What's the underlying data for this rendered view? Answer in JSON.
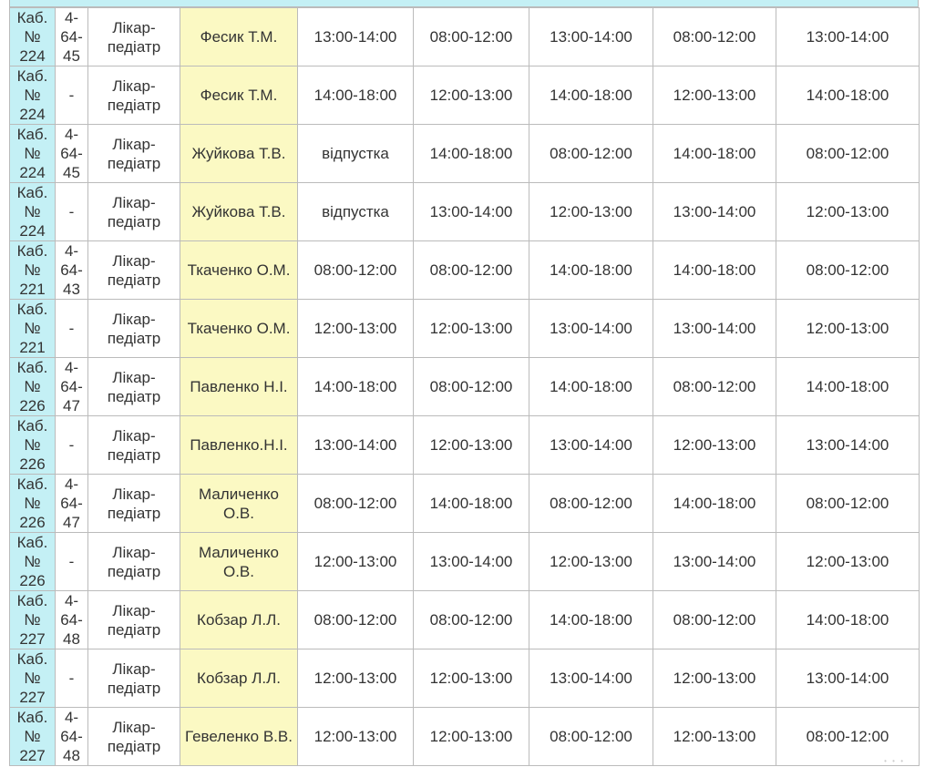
{
  "rows": [
    {
      "cab": [
        "Каб.",
        "№",
        "224"
      ],
      "phone": [
        "4-",
        "64-",
        "45"
      ],
      "role": [
        "Лікар-",
        "педіатр"
      ],
      "name": [
        "Фесик Т.М."
      ],
      "times": [
        "13:00-14:00",
        "08:00-12:00",
        "13:00-14:00",
        "08:00-12:00",
        "13:00-14:00"
      ]
    },
    {
      "cab": [
        "Каб.",
        "№",
        "224"
      ],
      "phone": [
        "-"
      ],
      "role": [
        "Лікар-",
        "педіатр"
      ],
      "name": [
        "Фесик Т.М."
      ],
      "times": [
        "14:00-18:00",
        "12:00-13:00",
        "14:00-18:00",
        "12:00-13:00",
        "14:00-18:00"
      ]
    },
    {
      "cab": [
        "Каб.",
        "№",
        "224"
      ],
      "phone": [
        "4-",
        "64-",
        "45"
      ],
      "role": [
        "Лікар-",
        "педіатр"
      ],
      "name": [
        "Жуйкова Т.В."
      ],
      "times": [
        "відпустка",
        "14:00-18:00",
        "08:00-12:00",
        "14:00-18:00",
        "08:00-12:00"
      ]
    },
    {
      "cab": [
        "Каб.",
        "№",
        "224"
      ],
      "phone": [
        "-"
      ],
      "role": [
        "Лікар-",
        "педіатр"
      ],
      "name": [
        "Жуйкова Т.В."
      ],
      "times": [
        "відпустка",
        "13:00-14:00",
        "12:00-13:00",
        "13:00-14:00",
        "12:00-13:00"
      ]
    },
    {
      "cab": [
        "Каб.",
        "№",
        "221"
      ],
      "phone": [
        "4-",
        "64-",
        "43"
      ],
      "role": [
        "Лікар-",
        "педіатр"
      ],
      "name": [
        "Ткаченко О.М."
      ],
      "times": [
        "08:00-12:00",
        "08:00-12:00",
        "14:00-18:00",
        "14:00-18:00",
        "08:00-12:00"
      ]
    },
    {
      "cab": [
        "Каб.",
        "№",
        "221"
      ],
      "phone": [
        "-"
      ],
      "role": [
        "Лікар-",
        "педіатр"
      ],
      "name": [
        "Ткаченко О.М."
      ],
      "times": [
        "12:00-13:00",
        "12:00-13:00",
        "13:00-14:00",
        "13:00-14:00",
        "12:00-13:00"
      ]
    },
    {
      "cab": [
        "Каб.",
        "№",
        "226"
      ],
      "phone": [
        "4-",
        "64-",
        "47"
      ],
      "role": [
        "Лікар-",
        "педіатр"
      ],
      "name": [
        "Павленко Н.І."
      ],
      "times": [
        "14:00-18:00",
        "08:00-12:00",
        "14:00-18:00",
        "08:00-12:00",
        "14:00-18:00"
      ]
    },
    {
      "cab": [
        "Каб.",
        "№",
        "226"
      ],
      "phone": [
        "-"
      ],
      "role": [
        "Лікар-",
        "педіатр"
      ],
      "name": [
        "Павленко.Н.І."
      ],
      "times": [
        "13:00-14:00",
        "12:00-13:00",
        "13:00-14:00",
        "12:00-13:00",
        "13:00-14:00"
      ]
    },
    {
      "cab": [
        "Каб.",
        "№",
        "226"
      ],
      "phone": [
        "4-",
        "64-",
        "47"
      ],
      "role": [
        "Лікар-",
        "педіатр"
      ],
      "name": [
        "Маличенко",
        "О.В."
      ],
      "times": [
        "08:00-12:00",
        "14:00-18:00",
        "08:00-12:00",
        "14:00-18:00",
        "08:00-12:00"
      ]
    },
    {
      "cab": [
        "Каб.",
        "№",
        "226"
      ],
      "phone": [
        "-"
      ],
      "role": [
        "Лікар-",
        "педіатр"
      ],
      "name": [
        "Маличенко",
        "О.В."
      ],
      "times": [
        "12:00-13:00",
        "13:00-14:00",
        "12:00-13:00",
        "13:00-14:00",
        "12:00-13:00"
      ]
    },
    {
      "cab": [
        "Каб.",
        "№",
        "227"
      ],
      "phone": [
        "4-",
        "64-",
        "48"
      ],
      "role": [
        "Лікар-",
        "педіатр"
      ],
      "name": [
        "Кобзар Л.Л."
      ],
      "times": [
        "08:00-12:00",
        "08:00-12:00",
        "14:00-18:00",
        "08:00-12:00",
        "14:00-18:00"
      ]
    },
    {
      "cab": [
        "Каб.",
        "№",
        "227"
      ],
      "phone": [
        "-"
      ],
      "role": [
        "Лікар-",
        "педіатр"
      ],
      "name": [
        "Кобзар Л.Л."
      ],
      "times": [
        "12:00-13:00",
        "12:00-13:00",
        "13:00-14:00",
        "12:00-13:00",
        "13:00-14:00"
      ]
    },
    {
      "cab": [
        "Каб.",
        "№",
        "227"
      ],
      "phone": [
        "4-",
        "64-",
        "48"
      ],
      "role": [
        "Лікар-",
        "педіатр"
      ],
      "name": [
        "Гевеленко В.В."
      ],
      "times": [
        "12:00-13:00",
        "12:00-13:00",
        "08:00-12:00",
        "12:00-13:00",
        "08:00-12:00"
      ]
    }
  ],
  "colors": {
    "cab_bg": "#c4f0f5",
    "name_bg": "#fbf9c3",
    "border": "#bbbbbb",
    "text": "#333333"
  }
}
